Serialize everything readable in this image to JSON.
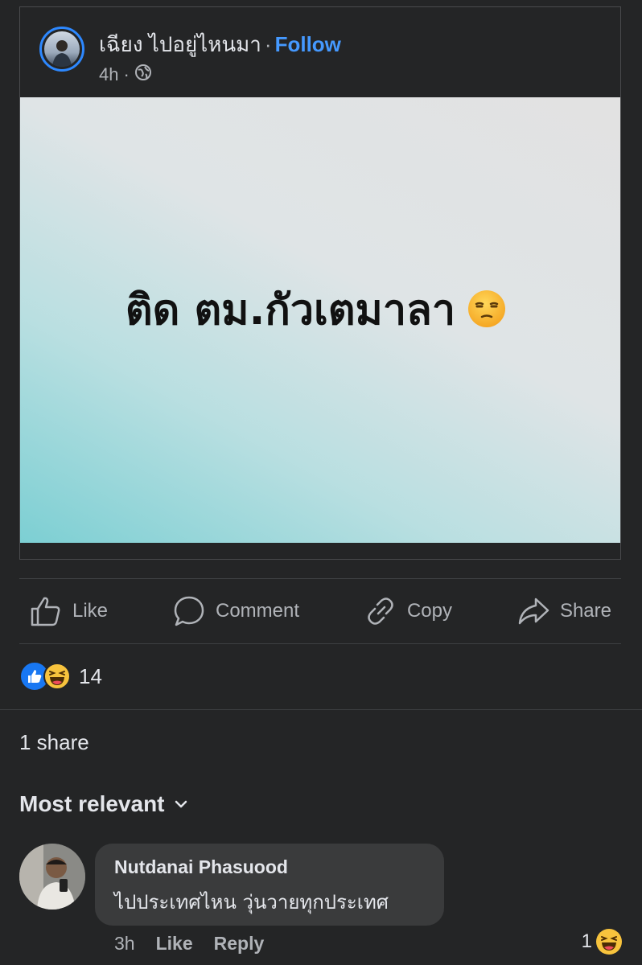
{
  "post": {
    "author": "เฉียง ไปอยู่ไหนมา",
    "separator": "·",
    "follow_label": "Follow",
    "time": "4h",
    "meta_separator": "·",
    "privacy_icon": "globe-icon",
    "text": "ติด ตม.กัวเตมาลา",
    "text_emoji": "unamused-face"
  },
  "actions": {
    "like": "Like",
    "comment": "Comment",
    "copy": "Copy",
    "share": "Share"
  },
  "reactions": {
    "types": [
      "like",
      "haha"
    ],
    "count": "14"
  },
  "share_count": "1 share",
  "sort_label": "Most relevant",
  "comment": {
    "author": "Nutdanai Phasuood",
    "text": "ไปประเทศไหน วุ่นวายทุกประเทศ",
    "time": "3h",
    "like_label": "Like",
    "reply_label": "Reply",
    "reaction_count": "1",
    "reaction_type": "haha"
  },
  "colors": {
    "background": "#242526",
    "accent": "#4599ff",
    "bubble": "#3a3b3c"
  }
}
